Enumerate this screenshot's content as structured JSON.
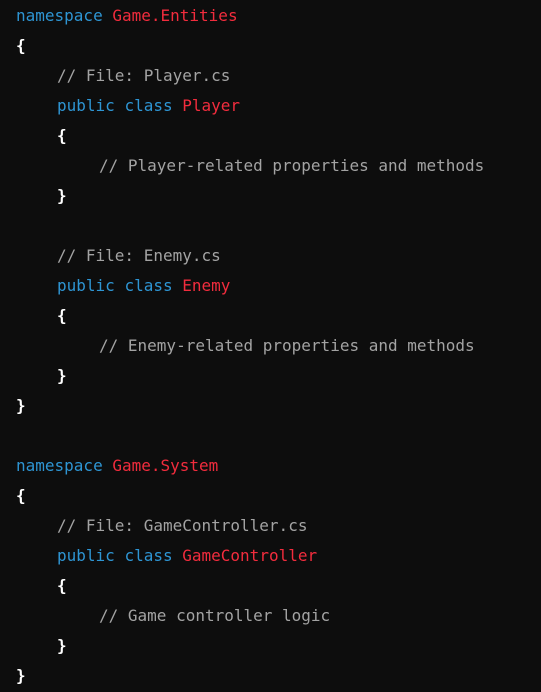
{
  "code": {
    "ns1_keyword": "namespace",
    "ns1_name": "Game.Entities",
    "ns1_open": "{",
    "player_comment": "// File: Player.cs",
    "player_public": "public",
    "player_class": "class",
    "player_name": "Player",
    "player_open": "{",
    "player_body": "// Player-related properties and methods",
    "player_close": "}",
    "enemy_comment": "// File: Enemy.cs",
    "enemy_public": "public",
    "enemy_class": "class",
    "enemy_name": "Enemy",
    "enemy_open": "{",
    "enemy_body": "// Enemy-related properties and methods",
    "enemy_close": "}",
    "ns1_close": "}",
    "ns2_keyword": "namespace",
    "ns2_name": "Game.System",
    "ns2_open": "{",
    "gc_comment": "// File: GameController.cs",
    "gc_public": "public",
    "gc_class": "class",
    "gc_name": "GameController",
    "gc_open": "{",
    "gc_body": "// Game controller logic",
    "gc_close": "}",
    "ns2_close": "}"
  },
  "colors": {
    "background": "#0d0d0d",
    "keyword": "#2e95d3",
    "type_name": "#f22c3d",
    "comment": "#a3a3a3",
    "punctuation": "#ffffff"
  }
}
